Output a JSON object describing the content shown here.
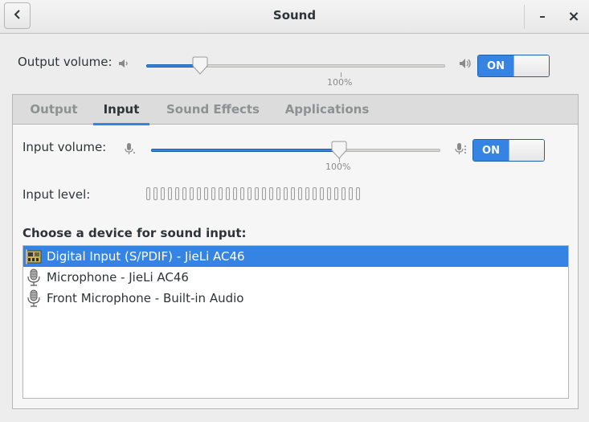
{
  "window": {
    "title": "Sound",
    "minimize_glyph": "–",
    "close_glyph": "×"
  },
  "output": {
    "label": "Output volume:",
    "volume_fraction": 0.18,
    "tick_label": "100%",
    "switch_label": "ON",
    "switch_on": true
  },
  "tabs": [
    {
      "label": "Output",
      "active": false
    },
    {
      "label": "Input",
      "active": true
    },
    {
      "label": "Sound Effects",
      "active": false
    },
    {
      "label": "Applications",
      "active": false
    }
  ],
  "input": {
    "label": "Input volume:",
    "volume_fraction": 0.65,
    "tick_label": "100%",
    "switch_label": "ON",
    "switch_on": true,
    "level_label": "Input level:",
    "level_segments": 30,
    "level_filled": 0
  },
  "device_section": {
    "label": "Choose a device for sound input:",
    "devices": [
      {
        "label": "Digital Input (S/PDIF) - JieLi AC46",
        "icon": "audio-card-icon",
        "selected": true
      },
      {
        "label": "Microphone - JieLi AC46",
        "icon": "microphone-icon",
        "selected": false
      },
      {
        "label": "Front Microphone - Built-in Audio",
        "icon": "microphone-icon",
        "selected": false
      }
    ]
  },
  "colors": {
    "accent": "#3584e4",
    "background": "#ededed"
  }
}
